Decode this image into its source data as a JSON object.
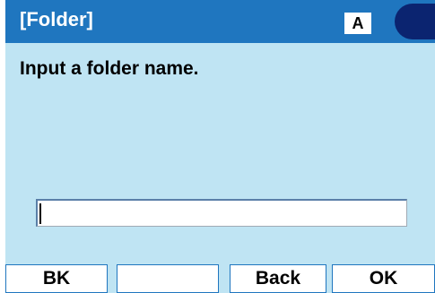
{
  "header": {
    "title": "[Folder]",
    "input_mode": "A"
  },
  "content": {
    "prompt": "Input a folder name."
  },
  "folder_name_input": {
    "value": ""
  },
  "softkeys": {
    "key1": "BK",
    "key2": "",
    "key3": "Back",
    "key4": "OK"
  },
  "colors": {
    "title_bar": "#1f76bf",
    "body_background": "#bfe4f3",
    "corner_shape": "#0b2470"
  }
}
